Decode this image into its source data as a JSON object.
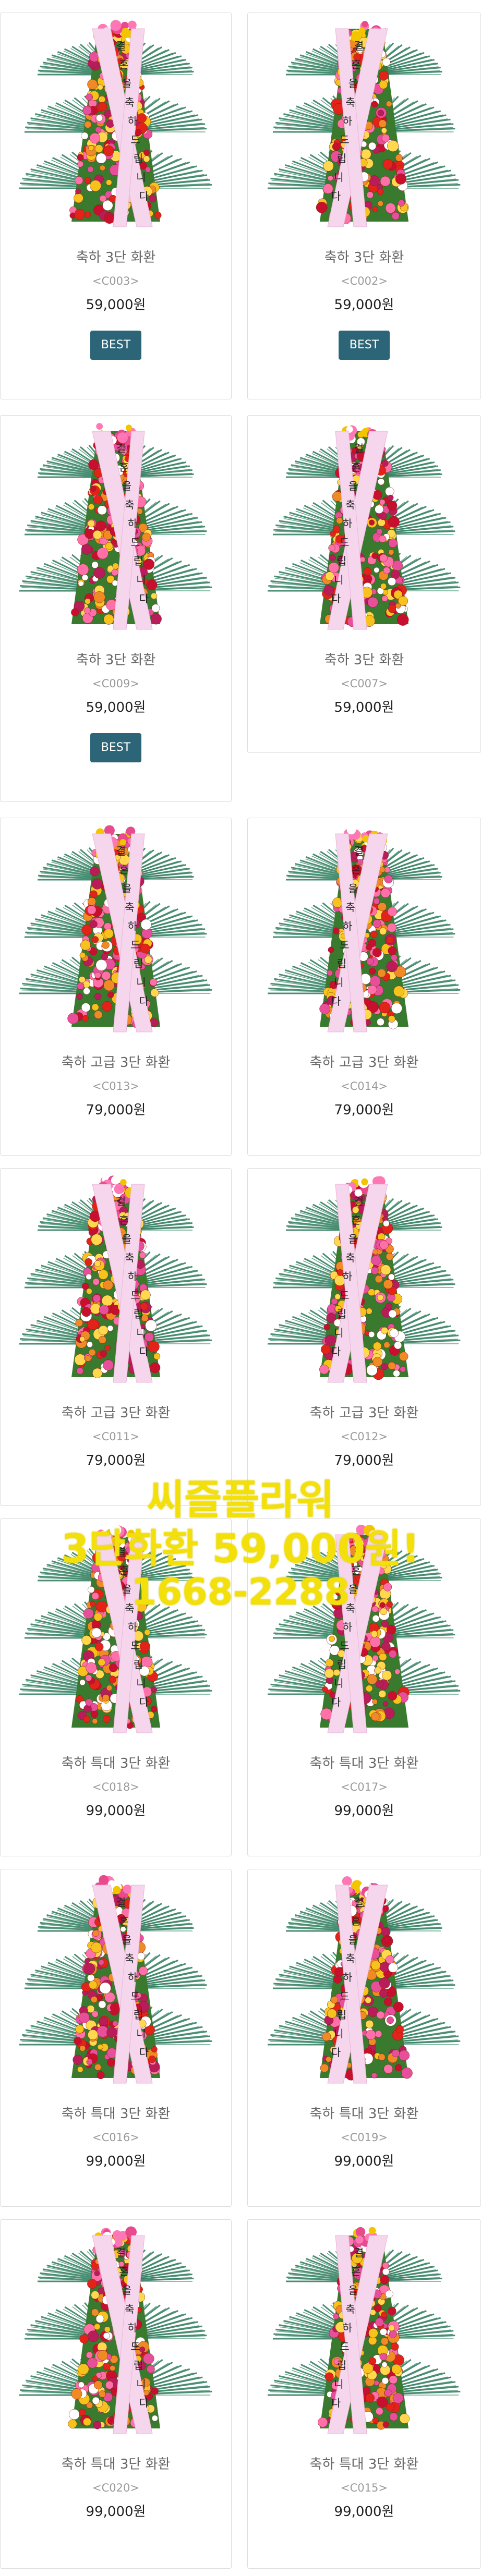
{
  "products": [
    {
      "name": "축하 3단 화환",
      "code": "<C003>",
      "price": "59,000원",
      "best": "BEST",
      "ribbon": "결혼을 축하드립니다"
    },
    {
      "name": "축하 3단 화환",
      "code": "<C002>",
      "price": "59,000원",
      "best": "BEST",
      "ribbon": "결혼을 축하드립니다"
    },
    {
      "name": "축하 3단 화환",
      "code": "<C009>",
      "price": "59,000원",
      "best": "BEST",
      "ribbon": "결혼을 축하드립니다"
    },
    {
      "name": "축하 3단 화환",
      "code": "<C007>",
      "price": "59,000원",
      "best": "",
      "ribbon": "결혼을 축하드립니다"
    },
    {
      "name": "축하 고급 3단 화환",
      "code": "<C013>",
      "price": "79,000원",
      "best": "",
      "ribbon": "결혼을 축하드립니다"
    },
    {
      "name": "축하 고급 3단 화환",
      "code": "<C014>",
      "price": "79,000원",
      "best": "",
      "ribbon": "결혼을 축하드립니다"
    },
    {
      "name": "축하 고급 3단 화환",
      "code": "<C011>",
      "price": "79,000원",
      "best": "",
      "ribbon": "결혼을 축하드립니다"
    },
    {
      "name": "축하 고급 3단 화환",
      "code": "<C012>",
      "price": "79,000원",
      "best": "",
      "ribbon": "결혼을 축하드립니다"
    },
    {
      "name": "축하 특대 3단 화환",
      "code": "<C018>",
      "price": "99,000원",
      "best": "",
      "ribbon": "결혼을 축하드립니다"
    },
    {
      "name": "축하 특대 3단 화환",
      "code": "<C017>",
      "price": "99,000원",
      "best": "",
      "ribbon": "결혼을 축하드립니다"
    },
    {
      "name": "축하 특대 3단 화환",
      "code": "<C016>",
      "price": "99,000원",
      "best": "",
      "ribbon": "결혼을 축하드립니다"
    },
    {
      "name": "축하 특대 3단 화환",
      "code": "<C019>",
      "price": "99,000원",
      "best": "",
      "ribbon": "결혼을 축하드립니다"
    },
    {
      "name": "축하 특대 3단 화환",
      "code": "<C020>",
      "price": "99,000원",
      "best": "",
      "ribbon": "결혼을 축하드립니다"
    },
    {
      "name": "축하 특대 3단 화환",
      "code": "<C015>",
      "price": "99,000원",
      "best": "",
      "ribbon": "결혼을 축하드립니다"
    }
  ],
  "overlay": {
    "line1": "씨즐플라워",
    "line2": "3단화환 59,000원!",
    "line3": "1668-2288"
  },
  "colors": {
    "best_button": "#2c6577",
    "overlay_text": "#f3df0a",
    "card_border": "#dcdcdc",
    "ribbon": "#f6d6ec",
    "fan_leaf": "#2f7a5c"
  },
  "icons": {
    "product_image": "wreath-image"
  }
}
